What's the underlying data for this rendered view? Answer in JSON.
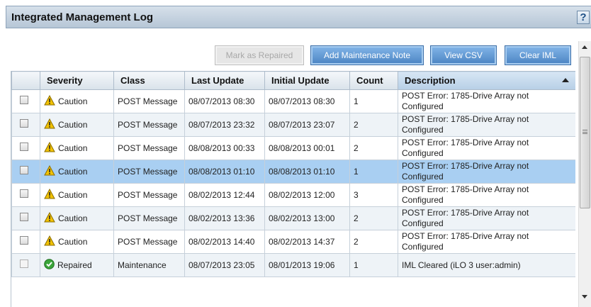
{
  "header": {
    "title": "Integrated Management Log",
    "help_label": "?"
  },
  "toolbar": {
    "mark_repaired": "Mark as Repaired",
    "add_note": "Add Maintenance Note",
    "view_csv": "View CSV",
    "clear_iml": "Clear IML"
  },
  "table": {
    "columns": [
      "",
      "Severity",
      "Class",
      "Last Update",
      "Initial Update",
      "Count",
      "Description"
    ],
    "rows": [
      {
        "severity": "Caution",
        "class": "POST Message",
        "last_update": "08/07/2013 08:30",
        "initial_update": "08/07/2013 08:30",
        "count": "1",
        "description": "POST Error: 1785-Drive Array not Configured",
        "selected": false
      },
      {
        "severity": "Caution",
        "class": "POST Message",
        "last_update": "08/07/2013 23:32",
        "initial_update": "08/07/2013 23:07",
        "count": "2",
        "description": "POST Error: 1785-Drive Array not Configured",
        "selected": false
      },
      {
        "severity": "Caution",
        "class": "POST Message",
        "last_update": "08/08/2013 00:33",
        "initial_update": "08/08/2013 00:01",
        "count": "2",
        "description": "POST Error: 1785-Drive Array not Configured",
        "selected": false
      },
      {
        "severity": "Caution",
        "class": "POST Message",
        "last_update": "08/08/2013 01:10",
        "initial_update": "08/08/2013 01:10",
        "count": "1",
        "description": "POST Error: 1785-Drive Array not Configured",
        "selected": true
      },
      {
        "severity": "Caution",
        "class": "POST Message",
        "last_update": "08/02/2013 12:44",
        "initial_update": "08/02/2013 12:00",
        "count": "3",
        "description": "POST Error: 1785-Drive Array not Configured",
        "selected": false
      },
      {
        "severity": "Caution",
        "class": "POST Message",
        "last_update": "08/02/2013 13:36",
        "initial_update": "08/02/2013 13:00",
        "count": "2",
        "description": "POST Error: 1785-Drive Array not Configured",
        "selected": false
      },
      {
        "severity": "Caution",
        "class": "POST Message",
        "last_update": "08/02/2013 14:40",
        "initial_update": "08/02/2013 14:37",
        "count": "2",
        "description": "POST Error: 1785-Drive Array not Configured",
        "selected": false
      },
      {
        "severity": "Repaired",
        "class": "Maintenance",
        "last_update": "08/07/2013 23:05",
        "initial_update": "08/01/2013 19:06",
        "count": "1",
        "description": "IML Cleared (iLO 3 user:admin)",
        "selected": false
      }
    ]
  },
  "icons": {
    "caution": "warning-triangle-icon",
    "repaired": "check-circle-icon"
  },
  "colors": {
    "accent": "#5a90cc",
    "selected_row": "#a9cff2",
    "caution": "#f2c200",
    "repaired": "#3aa53a"
  }
}
